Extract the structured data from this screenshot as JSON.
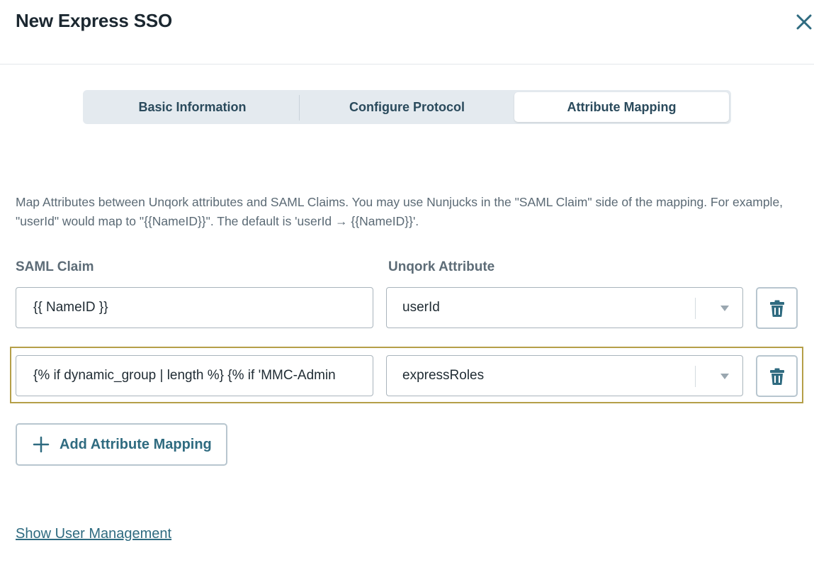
{
  "dialog": {
    "title": "New Express SSO",
    "close_icon": "close-icon"
  },
  "tabs": [
    {
      "label": "Basic Information",
      "active": false
    },
    {
      "label": "Configure Protocol",
      "active": false
    },
    {
      "label": "Attribute Mapping",
      "active": true
    }
  ],
  "description": "Map Attributes between Unqork attributes and SAML Claims. You may use Nunjucks in the \"SAML Claim\" side of the mapping. For example, \"userId\" would map to \"{{NameID}}\". The default is 'userId → {{NameID}}'.",
  "columns": {
    "saml_claim": "SAML Claim",
    "unqork_attribute": "Unqork Attribute"
  },
  "mappings": [
    {
      "saml_claim": "{{ NameID }}",
      "attribute": "userId"
    },
    {
      "saml_claim": "{% if dynamic_group | length %} {% if 'MMC-Admin",
      "attribute": "expressRoles"
    }
  ],
  "add_button_label": "Add Attribute Mapping",
  "show_user_management_label": "Show User Management",
  "colors": {
    "accent": "#2f6b80",
    "highlight_border": "#b59f48",
    "tab_bg": "#e4eaef"
  }
}
